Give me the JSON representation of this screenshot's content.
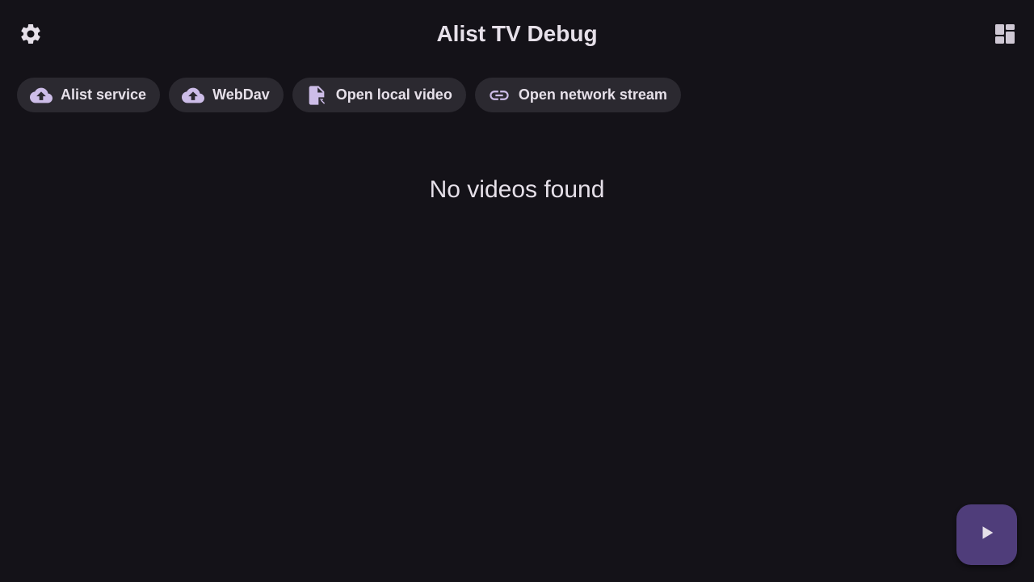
{
  "app": {
    "title": "Alist TV Debug"
  },
  "header": {
    "settings_icon": "gear-icon",
    "layout_icon": "dashboard-icon"
  },
  "chips": [
    {
      "label": "Alist service",
      "icon": "cloud-upload-icon"
    },
    {
      "label": "WebDav",
      "icon": "cloud-upload-icon"
    },
    {
      "label": "Open local video",
      "icon": "file-open-icon"
    },
    {
      "label": "Open network stream",
      "icon": "link-icon"
    }
  ],
  "main": {
    "empty_message": "No videos found"
  },
  "fab": {
    "icon": "play-icon"
  },
  "colors": {
    "background": "#141218",
    "chip_background": "#2b2930",
    "chip_icon": "#cdbde8",
    "text": "#e6e0e9",
    "fab_background": "#4f3d7a"
  }
}
